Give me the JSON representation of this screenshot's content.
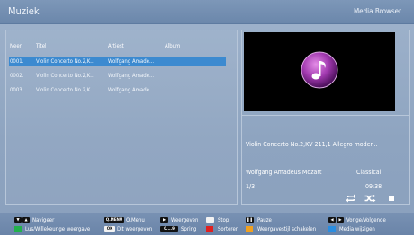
{
  "header": {
    "title": "Muziek",
    "subtitle": "Media Browser"
  },
  "list": {
    "columns": {
      "no": "Neen",
      "title": "Titel",
      "artist": "Artiest",
      "album": "Album"
    },
    "rows": [
      {
        "no": "0001.",
        "title": "Violin Concerto No.2,K...",
        "artist": "Wolfgang Amade...",
        "album": ""
      },
      {
        "no": "0002.",
        "title": "Violin Concerto No.2,K...",
        "artist": "Wolfgang Amade...",
        "album": ""
      },
      {
        "no": "0003.",
        "title": "Violin Concerto No.2,K...",
        "artist": "Wolfgang Amade...",
        "album": ""
      }
    ],
    "selected_index": 0
  },
  "info": {
    "track_title": "Violin Concerto No.2,KV 211,1 Allegro moder...",
    "artist": "Wolfgang Amadeus Mozart",
    "genre": "Classical",
    "position": "1/3",
    "time": "09:38"
  },
  "footer": {
    "navigate": "Navigeer",
    "menu_key": "Q.MENU",
    "menu": "Q.Menu",
    "play": "Weergeven",
    "stop": "Stop",
    "pause": "Pauze",
    "prevnext": "Vorige/Volgende",
    "loop": "Lus/Willekeurige weergave",
    "ok_key": "OK",
    "ok": "Dit weergeven",
    "jump_key": "0....9",
    "jump": "Spring",
    "sort": "Sorteren",
    "view_switch": "Weergavestijl schakelen",
    "media_change": "Media wijzigen"
  },
  "colors": {
    "selected_row": "#3c8ad0",
    "green": "#22b14c",
    "red": "#e02020",
    "yellow": "#f0a020",
    "blue": "#2a8de0"
  }
}
